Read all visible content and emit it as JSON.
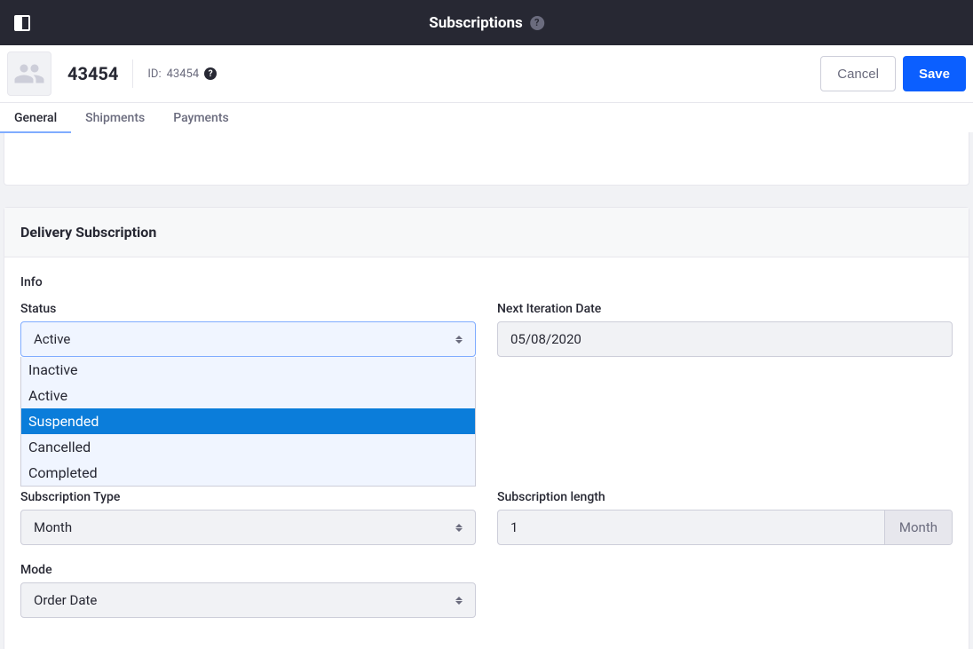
{
  "topbar": {
    "title": "Subscriptions"
  },
  "header": {
    "entity_number": "43454",
    "id_prefix": "ID:",
    "id_value": "43454",
    "cancel_label": "Cancel",
    "save_label": "Save"
  },
  "tabs": {
    "general": "General",
    "shipments": "Shipments",
    "payments": "Payments"
  },
  "card": {
    "title": "Delivery Subscription",
    "info_label": "Info",
    "status": {
      "label": "Status",
      "selected": "Active",
      "highlighted": "Suspended",
      "options": [
        "Inactive",
        "Active",
        "Suspended",
        "Cancelled",
        "Completed"
      ]
    },
    "next_iteration": {
      "label": "Next Iteration Date",
      "value": "05/08/2020"
    },
    "subscription_type": {
      "label": "Subscription Type",
      "selected": "Month"
    },
    "subscription_length": {
      "label": "Subscription length",
      "value": "1",
      "unit": "Month"
    },
    "mode": {
      "label": "Mode",
      "selected": "Order Date"
    }
  }
}
